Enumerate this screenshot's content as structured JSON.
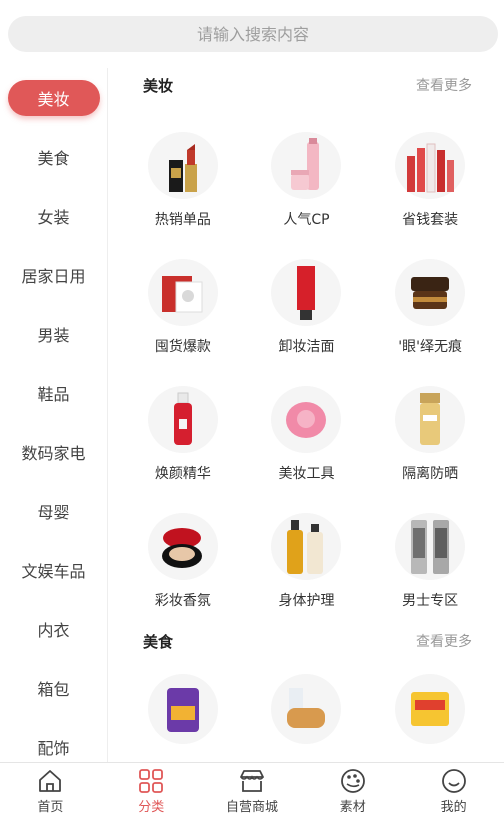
{
  "search": {
    "placeholder": "请输入搜索内容"
  },
  "sidebar": {
    "items": [
      {
        "label": "美妆",
        "active": true
      },
      {
        "label": "美食"
      },
      {
        "label": "女装"
      },
      {
        "label": "居家日用"
      },
      {
        "label": "男装"
      },
      {
        "label": "鞋品"
      },
      {
        "label": "数码家电"
      },
      {
        "label": "母婴"
      },
      {
        "label": "文娱车品"
      },
      {
        "label": "内衣"
      },
      {
        "label": "箱包"
      },
      {
        "label": "配饰"
      }
    ]
  },
  "sections": [
    {
      "title": "美妆",
      "more": "查看更多",
      "items": [
        {
          "label": "热销单品",
          "icon": "lipstick-icon"
        },
        {
          "label": "人气CP",
          "icon": "skincare-set-icon"
        },
        {
          "label": "省钱套装",
          "icon": "bottle-set-icon"
        },
        {
          "label": "囤货爆款",
          "icon": "face-mask-icon"
        },
        {
          "label": "卸妆洁面",
          "icon": "cleanser-tube-icon"
        },
        {
          "label": "'眼'绎无痕",
          "icon": "eye-cream-jar-icon"
        },
        {
          "label": "焕颜精华",
          "icon": "serum-bottle-icon"
        },
        {
          "label": "美妆工具",
          "icon": "cleansing-brush-icon"
        },
        {
          "label": "隔离防晒",
          "icon": "sunscreen-icon"
        },
        {
          "label": "彩妆香氛",
          "icon": "cushion-compact-icon"
        },
        {
          "label": "身体护理",
          "icon": "body-care-bottles-icon"
        },
        {
          "label": "男士专区",
          "icon": "men-bottles-icon"
        }
      ]
    },
    {
      "title": "美食",
      "more": "查看更多",
      "items": [
        {
          "icon": "snack-bag-icon"
        },
        {
          "icon": "bread-icon"
        },
        {
          "icon": "biscuit-pack-icon"
        }
      ]
    }
  ],
  "bottom_nav": [
    {
      "label": "首页",
      "icon": "home-icon"
    },
    {
      "label": "分类",
      "icon": "category-grid-icon",
      "active": true
    },
    {
      "label": "自营商城",
      "icon": "store-icon"
    },
    {
      "label": "素材",
      "icon": "palette-icon"
    },
    {
      "label": "我的",
      "icon": "smile-face-icon"
    }
  ],
  "colors": {
    "accent": "#e05858",
    "search_bg": "#eeeeee",
    "text": "#333333",
    "muted": "#999999"
  }
}
